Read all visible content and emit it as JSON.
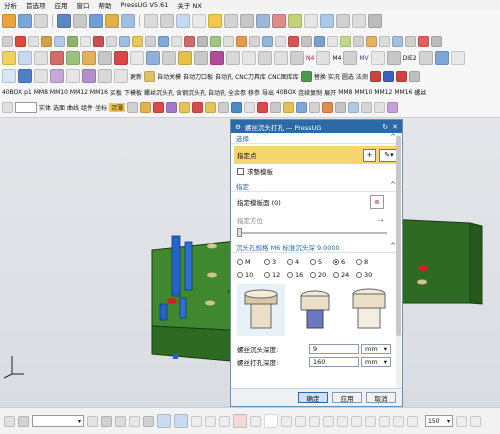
{
  "menu": [
    "分析",
    "首选项",
    "应用",
    "窗口",
    "帮助",
    "PressUG V5.61",
    "关于 NX"
  ],
  "toolbar3": [
    "更新",
    "自动关模",
    "自动刀口板",
    "自动孔",
    "CNC刀具库",
    "CNC图库库",
    "替换",
    "实况",
    "圆选",
    "法测"
  ],
  "toolbar4": [
    "40BOX",
    "p1",
    "MM8",
    "MM10",
    "MM12",
    "MM16",
    "买板",
    "下模板",
    "螺丝沉头孔",
    "含钢沉头孔",
    "自动孔",
    "全余参",
    "移参",
    "导出",
    "40BOX",
    "连续复制",
    "展开",
    "MM8",
    "MM10",
    "MM12",
    "MM16",
    "螺丝"
  ],
  "toolbar5": {
    "items": [
      "实体",
      "选面",
      "曲线",
      "组件",
      "坐标",
      "沉薄"
    ],
    "combo": ""
  },
  "toolbar2": {
    "labels": [
      "N4",
      "M4",
      "MV",
      "DIE2"
    ]
  },
  "dialog": {
    "title": "螺丝沉头打孔 — PressUG",
    "section_select": "选择",
    "specify_point": "指定点",
    "require_template": "求整模板",
    "section_specify": "指定",
    "specify_plate": "指定模板面 (0)",
    "specify_direction": "指定方位",
    "section_spec": "沉头孔规格 M6   标准沉头深 9.0000",
    "sizes": [
      "M",
      "3",
      "4",
      "5",
      "6",
      "8",
      "10",
      "12",
      "16",
      "20",
      "24",
      "30"
    ],
    "selected_size": "6",
    "depth_label": "螺丝沉头深度:",
    "depth_value": "9",
    "depth_unit": "mm",
    "drill_label": "螺丝打孔深度:",
    "drill_value": "160",
    "drill_unit": "mm",
    "ok": "确定",
    "apply": "应用",
    "cancel": "取消"
  },
  "bottombar": {
    "zoom": "150"
  },
  "colors": {
    "titlebar": "#2b6aa7",
    "highlight": "#f5d66e",
    "plate": "#3a7a2c",
    "pins": "#2563c8"
  }
}
